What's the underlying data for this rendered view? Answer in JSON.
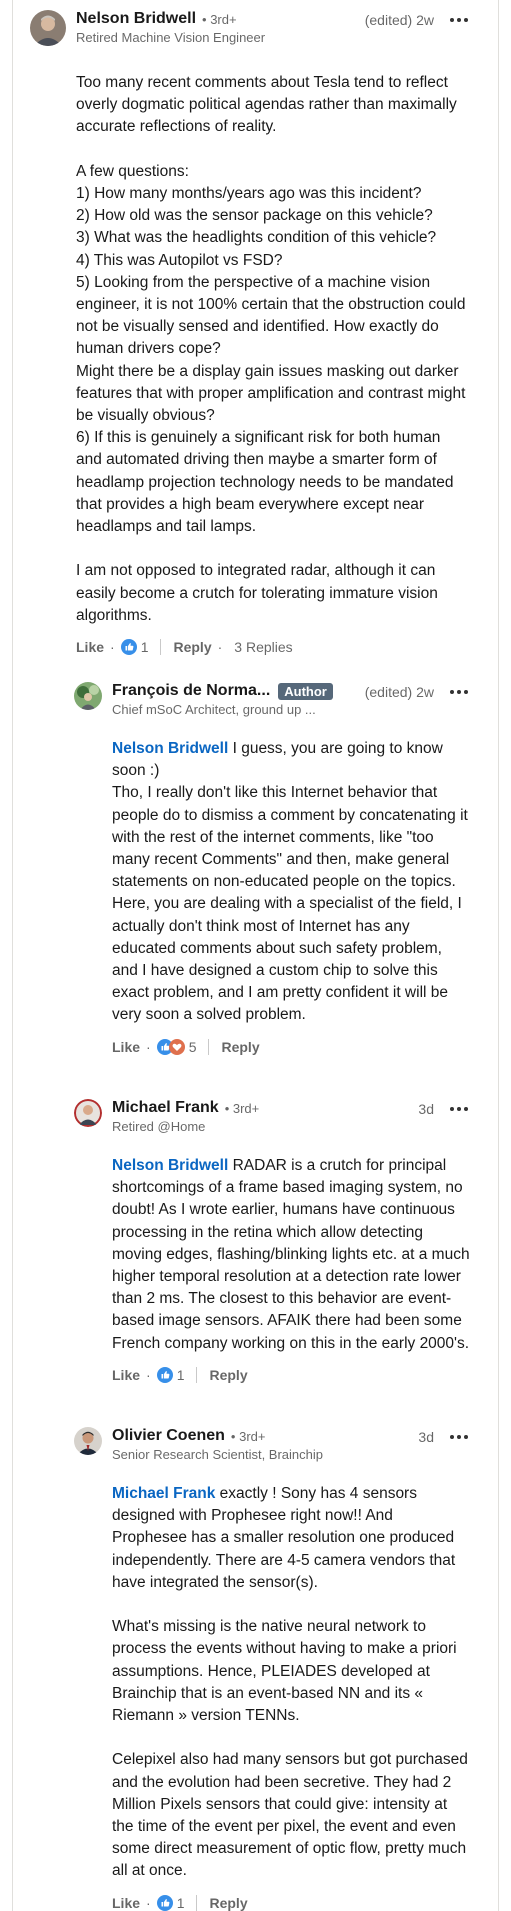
{
  "colors": {
    "link": "#0a66c2",
    "badge": "#56687a",
    "like": "#378fe9",
    "love": "#df704d"
  },
  "comment_main": {
    "name": "Nelson Bridwell",
    "degree": "• 3rd+",
    "headline": "Retired Machine Vision Engineer",
    "meta": "(edited) 2w",
    "body": "Too many recent comments about Tesla tend to reflect overly dogmatic political agendas rather than maximally accurate reflections of reality.\n\nA few questions:\n1) How many months/years ago was this incident?\n2) How old was the sensor package on this vehicle?\n3) What was the headlights condition of this vehicle?\n4) This was Autopilot vs FSD?\n5) Looking from the perspective of a machine vision engineer, it is not 100% certain that the obstruction could not be visually sensed and identified. How exactly do human drivers cope?\nMight there be a display gain issues masking out darker features that with proper amplification and contrast might be visually obvious?\n6) If this is genuinely a significant risk for both human and automated driving then maybe a smarter form of headlamp projection technology needs to be mandated that provides a high beam everywhere except near headlamps and tail lamps.\n\nI am not opposed to integrated radar, although it can easily become a crutch for tolerating immature vision algorithms.",
    "like_label": "Like",
    "reaction_count": "1",
    "reply_label": "Reply",
    "replies": "3 Replies",
    "icons": [
      "like-icon"
    ]
  },
  "reply_1": {
    "name": "François de Norma...",
    "badge": "Author",
    "headline": "Chief mSoC Architect, ground up ...",
    "meta": "(edited) 2w",
    "mention": "Nelson Bridwell",
    "body": " I guess, you are going to know soon :)\nTho, I really don't like this Internet behavior that people do to dismiss a comment by concatenating it with the rest of the internet comments, like \"too many recent Comments\" and then, make general statements on non-educated people on the topics. Here, you are dealing with a specialist of the field, I actually don't think most of Internet has any educated comments about such safety problem, and I have designed a custom chip to solve this exact problem, and I am pretty confident it will be very soon a solved problem.",
    "like_label": "Like",
    "reaction_count": "5",
    "reply_label": "Reply",
    "icons": [
      "like-icon",
      "love-icon"
    ]
  },
  "reply_2": {
    "name": "Michael Frank",
    "degree": "• 3rd+",
    "headline": "Retired @Home",
    "meta": "3d",
    "mention": "Nelson Bridwell",
    "body": " RADAR is a crutch for principal shortcomings of a frame based imaging system, no doubt! As I wrote earlier, humans have continuous processing in the retina which allow detecting moving edges, flashing/blinking lights etc. at a much higher temporal resolution at a detection rate lower than 2 ms. The closest to this behavior are event-based image sensors. AFAIK there had been some French company working on this in the early 2000's.",
    "like_label": "Like",
    "reaction_count": "1",
    "reply_label": "Reply",
    "icons": [
      "like-icon"
    ]
  },
  "reply_3": {
    "name": "Olivier Coenen",
    "degree": "• 3rd+",
    "headline": "Senior Research Scientist, Brainchip",
    "meta": "3d",
    "mention": "Michael Frank",
    "body": " exactly ! Sony has 4 sensors designed with Prophesee right now!! And Prophesee has a smaller resolution one produced independently. There are 4-5 camera vendors that have integrated the sensor(s).\n\nWhat's missing is the native neural network to process the events without having to make a priori assumptions. Hence, PLEIADES developed at Brainchip that is an event-based NN and its « Riemann » version TENNs.\n\nCelepixel also had many sensors but got purchased and the evolution had been secretive. They had 2 Million Pixels sensors that could give: intensity at the time of the event per pixel, the event and even some direct measurement of optic flow, pretty much all at once.",
    "like_label": "Like",
    "reaction_count": "1",
    "reply_label": "Reply",
    "icons": [
      "like-icon"
    ]
  }
}
